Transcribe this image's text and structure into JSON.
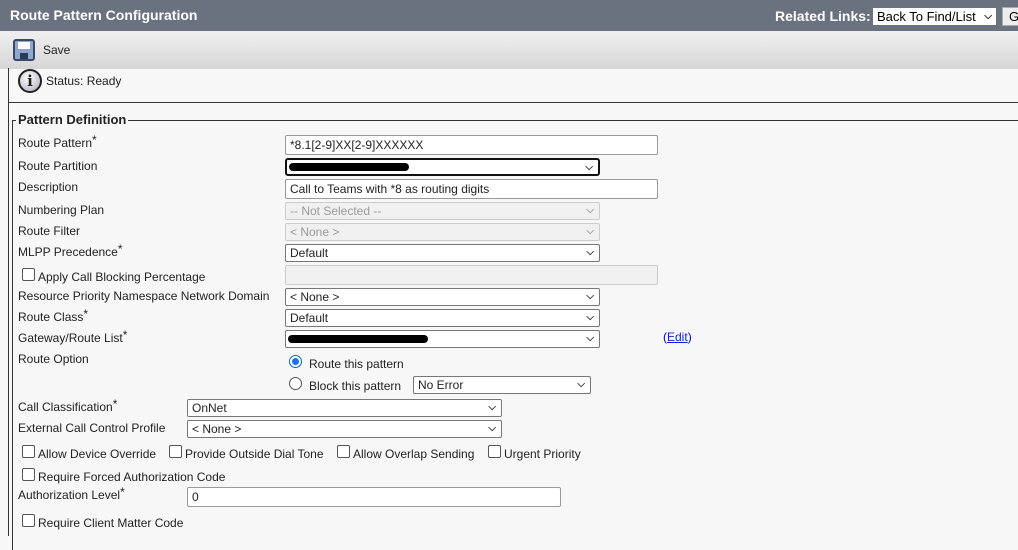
{
  "header": {
    "title": "Route Pattern Configuration",
    "related_links_label": "Related Links:",
    "related_links_value": "Back To Find/List",
    "go_label": "G"
  },
  "toolbar": {
    "save_label": "Save"
  },
  "status": {
    "text": "Status: Ready"
  },
  "section": {
    "legend": "Pattern Definition"
  },
  "fields": {
    "route_pattern": {
      "label": "Route Pattern",
      "value": "*8.1[2-9]XX[2-9]XXXXXX"
    },
    "route_partition": {
      "label": "Route Partition"
    },
    "description": {
      "label": "Description",
      "value": "Call to Teams with *8 as routing digits"
    },
    "numbering_plan": {
      "label": "Numbering Plan",
      "value": "-- Not Selected --"
    },
    "route_filter": {
      "label": "Route Filter",
      "value": "< None >"
    },
    "mlpp": {
      "label": "MLPP Precedence",
      "value": "Default"
    },
    "call_blocking": {
      "label": "Apply Call Blocking Percentage"
    },
    "rpn_domain": {
      "label": "Resource Priority Namespace Network Domain",
      "value": "< None >"
    },
    "route_class": {
      "label": "Route Class",
      "value": "Default"
    },
    "gateway": {
      "label": "Gateway/Route List",
      "edit_open": "(",
      "edit_label": "Edit",
      "edit_close": ")"
    },
    "route_option": {
      "label": "Route Option",
      "route_label": "Route this pattern",
      "block_label": "Block this pattern",
      "block_reason": "No Error",
      "selected": "route"
    },
    "call_classification": {
      "label": "Call Classification",
      "value": "OnNet"
    },
    "ext_profile": {
      "label": "External Call Control Profile",
      "value": "< None >"
    },
    "allow_device_override": {
      "label": "Allow Device Override",
      "checked": false
    },
    "outside_dial_tone": {
      "label": "Provide Outside Dial Tone",
      "checked": false
    },
    "overlap_sending": {
      "label": "Allow Overlap Sending",
      "checked": false
    },
    "urgent_priority": {
      "label": "Urgent Priority",
      "checked": false
    },
    "forced_auth": {
      "label": "Require Forced Authorization Code",
      "checked": false
    },
    "auth_level": {
      "label": "Authorization Level",
      "value": "0"
    },
    "client_matter": {
      "label": "Require Client Matter Code",
      "checked": false
    }
  },
  "required_mark": "*"
}
